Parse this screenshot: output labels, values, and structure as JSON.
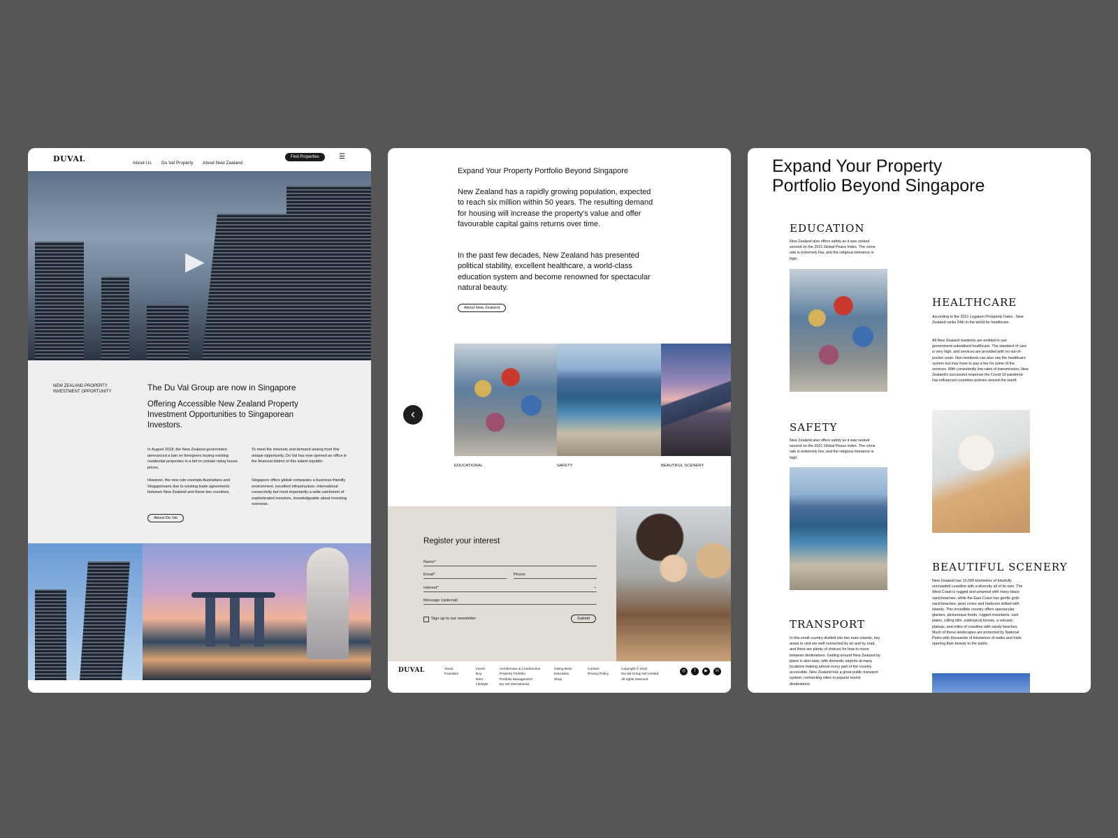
{
  "brand": {
    "logo": "DUVAL"
  },
  "nav": {
    "items": [
      "About Us",
      "Du Val Property",
      "About New Zealand"
    ],
    "cta": "Find Properties"
  },
  "hero": {
    "play": "▶"
  },
  "intro": {
    "eyebrow": "NEW ZEALAND PROPERTY\nINVESTMENT OPPORTUNITY",
    "title": "The Du Val Group are now in Singapore",
    "subtitle": "Offering Accessible New Zealand Property Investment Opportunities to Singaporean Investors.",
    "col1_p1": "In August 2018, the New Zealand government announced a ban on foreigners buying existing residential properties in a bid to contain rising house prices.",
    "col1_p2": "However, the new rule exempts Australians and Singaporeans due to existing trade agreements between New Zealand and these two countries.",
    "col2_p1": "To meet the interests and demand arising from this unique opportunity, Du Val has now opened an office in the financial district of this island republic.",
    "col2_p2": "Singapore offers global companies a business-friendly environment, excellent infrastructure, international connectivity but most importantly a wide catchment of  sophisticated investors, knowledgeable about investing overseas.",
    "button": "About Du Val"
  },
  "expand": {
    "heading": "Expand Your Property Portfolio Beyond Singapore",
    "p1": "New Zealand has a rapidly growing population, expected to reach six million within 50 years.  The resulting demand for housing will increase the property's value and offer favourable capital gains returns over time.",
    "p2": "In the past few decades, New Zealand has presented political stability, excellent healthcare, a world-class education system and become renowned for spectacular natural beauty.",
    "button": "About New Zealand"
  },
  "carousel": {
    "prev": "‹",
    "captions": [
      "EDUCATIONAL",
      "SAFETY",
      "BEAUTIFUL SCENERY"
    ]
  },
  "form": {
    "title": "Register your interest",
    "name": "Name*",
    "email": "Email*",
    "phone": "Phone",
    "interest": "Interest*",
    "message": "Message (optional)",
    "newsletter": "Sign up to our newsletter",
    "submit": "Submit"
  },
  "footer": {
    "logo": "DUVAL",
    "col1": [
      "About",
      "Founders"
    ],
    "col2": [
      "Invest",
      "Buy",
      "Rent",
      "Lifestyle"
    ],
    "col3": [
      "Architecture & Construction",
      "Property Portfolio",
      "Portfolio Management",
      "Du Val International"
    ],
    "col4": [
      "Giving Back",
      "Education",
      "Shop"
    ],
    "col5": [
      "Contact",
      "Privacy Policy"
    ],
    "copyright": [
      "Copyright © 2022",
      "Du Val Group NZ Limited",
      "All rights reserved"
    ],
    "social": [
      "instagram-icon",
      "facebook-icon",
      "youtube-icon",
      "linkedin-icon"
    ]
  },
  "categories": {
    "heading_line1": "Expand Your Property",
    "heading_line2": "Portfolio Beyond Singapore",
    "education": {
      "title": "EDUCATION",
      "text": "New Zealand also offers safety as it was ranked second on the 2021 Global Peace Index. The crime rate is extremely low, and the religious tolerance is high."
    },
    "healthcare": {
      "title": "HEALTHCARE",
      "text1": "According to the 2021 Legatum Prosperity Index , New Zealand ranks 24th in the world for healthcare.",
      "text2": "All New Zealand residents are entitled to use government-subsidised healthcare. The standard of care is very high, and services are provided with no out-of-pocket costs. Non-residents can also use the healthcare system but may have to pay a fee for some of the services. With consistently low rates of transmission, New Zealand's successful response the Covid-19 pandemic has influenced countless policies around the world."
    },
    "safety": {
      "title": "SAFETY",
      "text": "New Zealand also offers safety as it was ranked second on the 2021 Global Peace Index. The crime rate is extremely low, and the religious tolerance is high."
    },
    "scenery": {
      "title": "BEAUTIFUL SCENERY",
      "text": "New Zealand has 15,000 kilometres of blissfully uncrowded coastline with a diversity all of its own. The West Coast is rugged and untamed with many black-sand beaches, while the East Coast has gentle gold-sand beaches, quiet coves and harbours dotted with islands.  This incredible country offers spectacular glaciers, picturesque fiords, rugged mountains, vast plains, rolling hills, subtropical forests, a volcanic plateau, and miles of coastline with sandy beaches. Much of these landscapes are protected by National Parks with thousands of kilometres of walks and trails opening their beauty to the public."
    },
    "transport": {
      "title": "TRANSPORT",
      "text": "In this small country divided into two main islands, key areas to visit are well connected by air and by road, and there are plenty of choices for how to move between destinations. Getting around New Zealand by plane is also easy, with domestic airports at many locations making almost every part of the country accessible. New Zealand has a great public transport system, connecting cities to popular tourist destinations."
    }
  }
}
